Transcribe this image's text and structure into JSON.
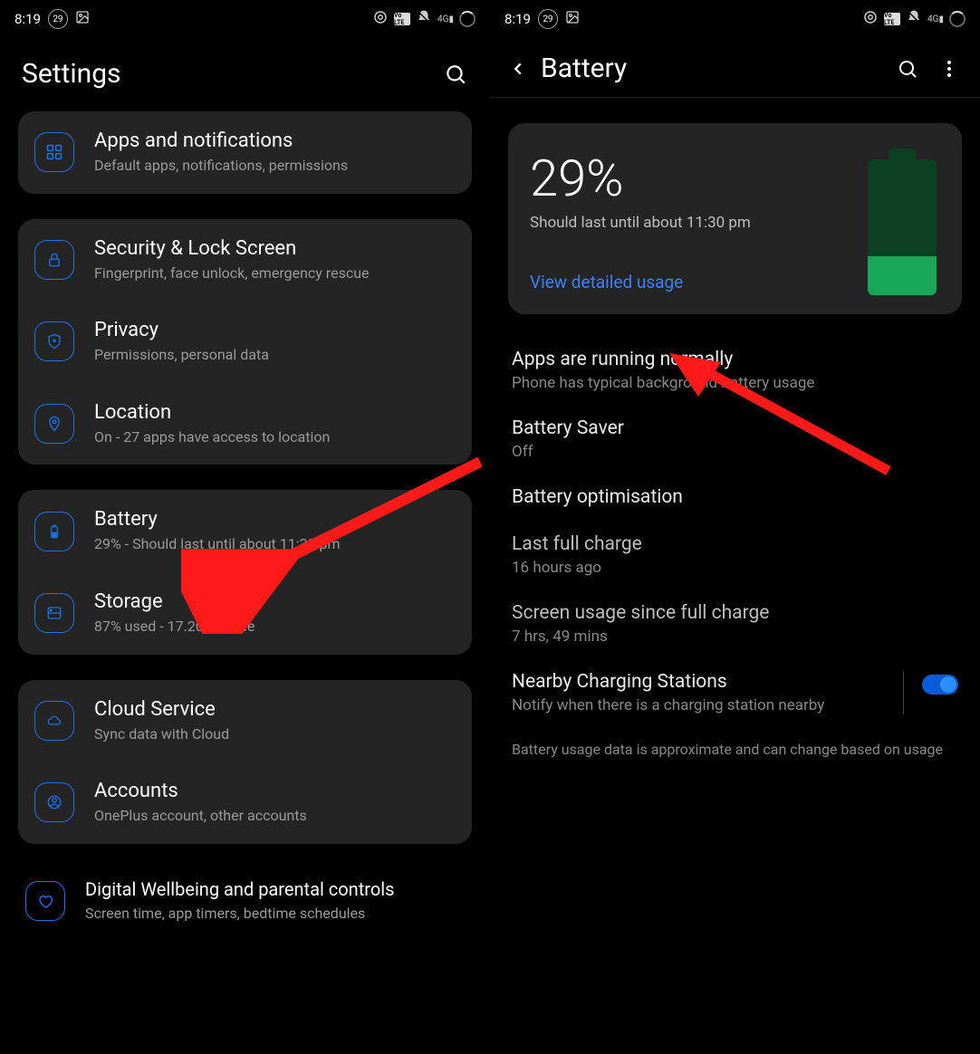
{
  "status": {
    "time": "8:19",
    "battery_badge": "29",
    "volte": "Vo LTE",
    "signal": "4G"
  },
  "left": {
    "title": "Settings",
    "items": {
      "apps": {
        "title": "Apps and notifications",
        "sub": "Default apps, notifications, permissions"
      },
      "security": {
        "title": "Security & Lock Screen",
        "sub": "Fingerprint, face unlock, emergency rescue"
      },
      "privacy": {
        "title": "Privacy",
        "sub": "Permissions, personal data"
      },
      "location": {
        "title": "Location",
        "sub": "On - 27 apps have access to location"
      },
      "battery": {
        "title": "Battery",
        "sub": "29% - Should last until about 11:30 pm"
      },
      "storage": {
        "title": "Storage",
        "sub": "87% used - 17.20 GB free"
      },
      "cloud": {
        "title": "Cloud Service",
        "sub": "Sync data with Cloud"
      },
      "accounts": {
        "title": "Accounts",
        "sub": "OnePlus account, other accounts"
      },
      "wellbeing": {
        "title": "Digital Wellbeing and parental controls",
        "sub": "Screen time, app timers, bedtime schedules"
      }
    }
  },
  "right": {
    "title": "Battery",
    "percent": "29%",
    "estimate": "Should last until about 11:30 pm",
    "link": "View detailed usage",
    "apps_status": {
      "t1": "Apps are running normally",
      "t2": "Phone has typical background battery usage"
    },
    "saver": {
      "t1": "Battery Saver",
      "t2": "Off"
    },
    "optimisation": {
      "t1": "Battery optimisation"
    },
    "last_charge": {
      "t1": "Last full charge",
      "t2": "16 hours ago"
    },
    "screen_usage": {
      "t1": "Screen usage since full charge",
      "t2": "7 hrs, 49 mins"
    },
    "nearby": {
      "t1": "Nearby Charging Stations",
      "t2": "Notify when there is a charging station nearby"
    },
    "footnote": "Battery usage data is approximate and can change based on usage"
  }
}
